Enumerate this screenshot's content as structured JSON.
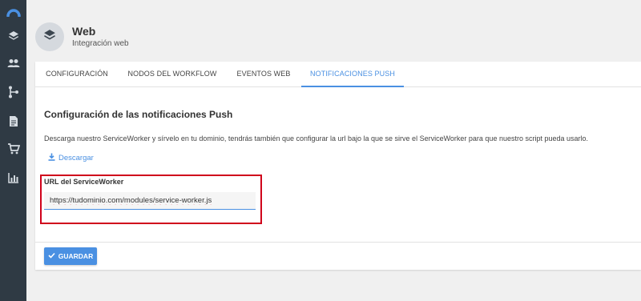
{
  "sidebar": {
    "items": [
      {
        "icon": "logo-arc-icon"
      },
      {
        "icon": "layers-icon"
      },
      {
        "icon": "users-icon"
      },
      {
        "icon": "workflow-icon"
      },
      {
        "icon": "document-icon"
      },
      {
        "icon": "cart-icon"
      },
      {
        "icon": "bar-chart-icon"
      }
    ]
  },
  "header": {
    "title": "Web",
    "subtitle": "Integración web",
    "icon": "layers-icon"
  },
  "tabs": [
    {
      "label": "CONFIGURACIÓN",
      "active": false
    },
    {
      "label": "NODOS DEL WORKFLOW",
      "active": false
    },
    {
      "label": "EVENTOS WEB",
      "active": false
    },
    {
      "label": "NOTIFICACIONES PUSH",
      "active": true
    }
  ],
  "content": {
    "section_title": "Configuración de las notificaciones Push",
    "description": "Descarga nuestro ServiceWorker y sírvelo en tu dominio, tendrás también que configurar la url bajo la que se sirve el ServiceWorker para que nuestro script pueda usarlo.",
    "download_label": "Descargar",
    "field_label": "URL del ServiceWorker",
    "field_value": "https://tudominio.com/modules/service-worker.js"
  },
  "footer": {
    "save_label": "GUARDAR"
  },
  "colors": {
    "sidebar_bg": "#2f3a44",
    "accent": "#4a90e2",
    "highlight": "#d0021b"
  }
}
